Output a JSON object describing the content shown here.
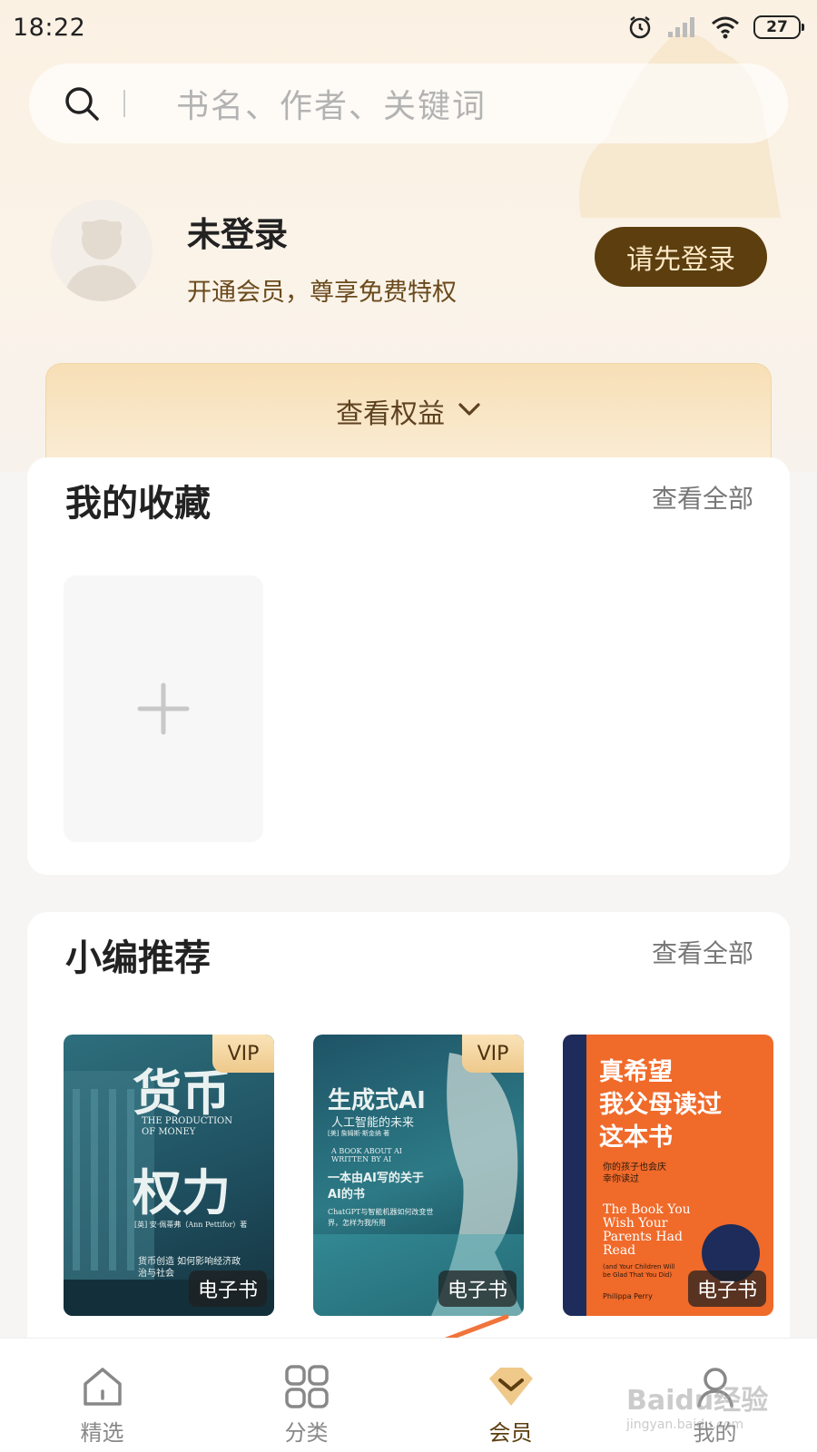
{
  "status_bar": {
    "time": "18:22",
    "battery": "27"
  },
  "search": {
    "placeholder": "书名、作者、关键词"
  },
  "profile": {
    "name": "未登录",
    "subtitle": "开通会员，尊享免费特权",
    "login_button": "请先登录"
  },
  "benefits": {
    "label": "查看权益"
  },
  "favorites": {
    "title": "我的收藏",
    "view_all": "查看全部"
  },
  "recommend": {
    "title": "小编推荐",
    "view_all": "查看全部",
    "books": [
      {
        "badge": "VIP",
        "type": "电子书",
        "title_a": "货币",
        "title_b": "权力",
        "subtitle_en": "THE PRODUCTION OF MONEY",
        "author": "[英] 安·佩蒂弗（Ann Pettifor）著",
        "tagline": "货币创造 如何影响经济政治与社会"
      },
      {
        "badge": "VIP",
        "type": "电子书",
        "title_a": "生成式AI",
        "title_b": "人工智能的未来",
        "subtitle_en": "A BOOK ABOUT AI WRITTEN BY AI",
        "author": "[美] 詹姆斯·斯金纳 著",
        "tagline": "一本由AI写的关于AI的书",
        "note": "ChatGPT与智能机器如何改变世界，怎样为我所用"
      },
      {
        "badge": "",
        "type": "电子书",
        "title_a": "真希望",
        "title_b": "我父母读过",
        "title_c": "这本书",
        "tagline": "你的孩子也会庆幸你读过",
        "en_title": "The Book You Wish Your Parents Had Read",
        "en_sub": "(and Your Children Will be Glad That You Did)",
        "author_en": "Philippa Perry"
      }
    ]
  },
  "bottom_nav": {
    "items": [
      {
        "label": "精选",
        "icon": "home-icon"
      },
      {
        "label": "分类",
        "icon": "grid-icon"
      },
      {
        "label": "会员",
        "icon": "vip-icon"
      },
      {
        "label": "我的",
        "icon": "person-icon"
      }
    ],
    "active_index": 2
  },
  "watermark": {
    "brand": "Baidu经验",
    "url": "jingyan.baidu.com"
  },
  "colors": {
    "accent": "#5c3e0f",
    "gold": "#efc98a",
    "arrow": "#f0743c"
  }
}
